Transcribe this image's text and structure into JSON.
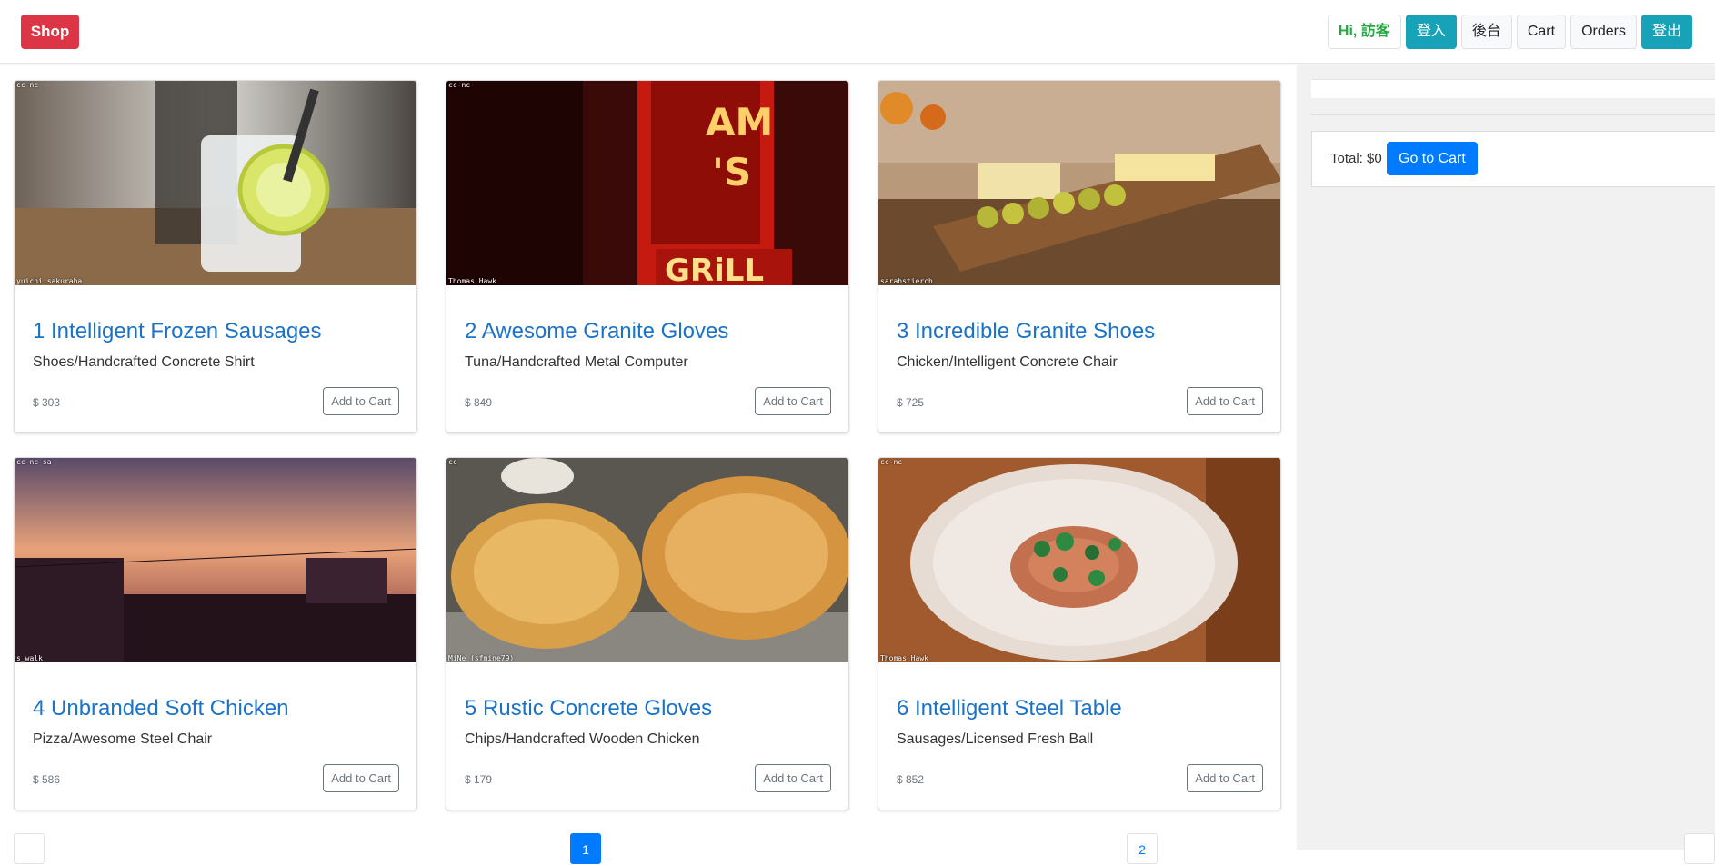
{
  "navbar": {
    "brand": "Shop",
    "greeting": "Hi, 訪客",
    "login": "登入",
    "admin": "後台",
    "cart": "Cart",
    "orders": "Orders",
    "logout": "登出"
  },
  "products": [
    {
      "title": "1 Intelligent Frozen Sausages",
      "subtitle": "Shoes/Handcrafted Concrete Shirt",
      "price": "$ 303",
      "add_label": "Add to Cart",
      "credit_top": "cc-nc",
      "credit_bottom": "yuichi.sakuraba"
    },
    {
      "title": "2 Awesome Granite Gloves",
      "subtitle": "Tuna/Handcrafted Metal Computer",
      "price": "$ 849",
      "add_label": "Add to Cart",
      "credit_top": "cc-nc",
      "credit_bottom": "Thomas Hawk"
    },
    {
      "title": "3 Incredible Granite Shoes",
      "subtitle": "Chicken/Intelligent Concrete Chair",
      "price": "$ 725",
      "add_label": "Add to Cart",
      "credit_top": "",
      "credit_bottom": "sarahstierch"
    },
    {
      "title": "4 Unbranded Soft Chicken",
      "subtitle": "Pizza/Awesome Steel Chair",
      "price": "$ 586",
      "add_label": "Add to Cart",
      "credit_top": "cc-nc-sa",
      "credit_bottom": "s_walk"
    },
    {
      "title": "5 Rustic Concrete Gloves",
      "subtitle": "Chips/Handcrafted Wooden Chicken",
      "price": "$ 179",
      "add_label": "Add to Cart",
      "credit_top": "cc",
      "credit_bottom": "MiNe (sfmine79)"
    },
    {
      "title": "6 Intelligent Steel Table",
      "subtitle": "Sausages/Licensed Fresh Ball",
      "price": "$ 852",
      "add_label": "Add to Cart",
      "credit_top": "cc-nc",
      "credit_bottom": "Thomas Hawk"
    }
  ],
  "cart_panel": {
    "total": "Total: $0",
    "go_to_cart": "Go to Cart"
  },
  "pagination": {
    "active": "1",
    "next": "2"
  }
}
